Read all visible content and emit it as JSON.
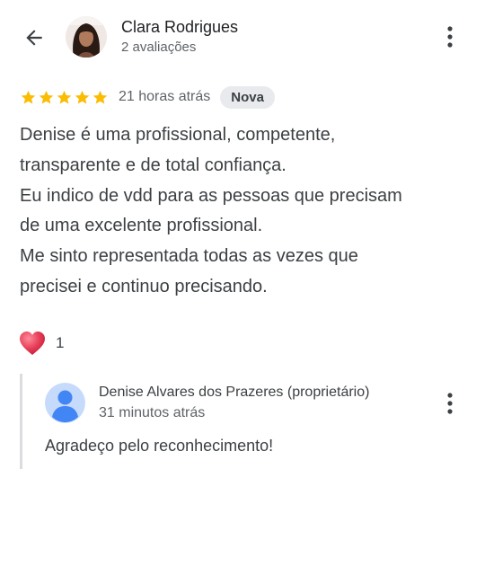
{
  "review": {
    "reviewer_name": "Clara Rodrigues",
    "reviewer_reviews_count": "2 avaliações",
    "rating": 5,
    "rating_max": 5,
    "time_ago": "21 horas atrás",
    "badge": "Nova",
    "text_lines": [
      "Denise é uma profissional, competente,",
      "transparente e de total confiança.",
      "Eu indico de vdd para as pessoas que precisam",
      "de uma excelente profissional.",
      "Me sinto representada todas as vezes que",
      "precisei e continuo precisando."
    ],
    "reaction_count": "1"
  },
  "owner_reply": {
    "name": "Denise Alvares dos Prazeres (proprietário)",
    "time_ago": "31 minutos atrás",
    "text": "Agradeço pelo reconhecimento!"
  },
  "icons": {
    "back": "arrow-back-icon",
    "more": "more-vertical-icon",
    "star": "star-icon",
    "reaction": "heart-icon",
    "owner_avatar": "default-person-avatar"
  },
  "colors": {
    "star": "#fbbc04",
    "heart": "#e8415b",
    "badge_bg": "#e8eaed",
    "owner_avatar_bg": "#c6dafc",
    "owner_avatar_fg": "#4285f4"
  }
}
